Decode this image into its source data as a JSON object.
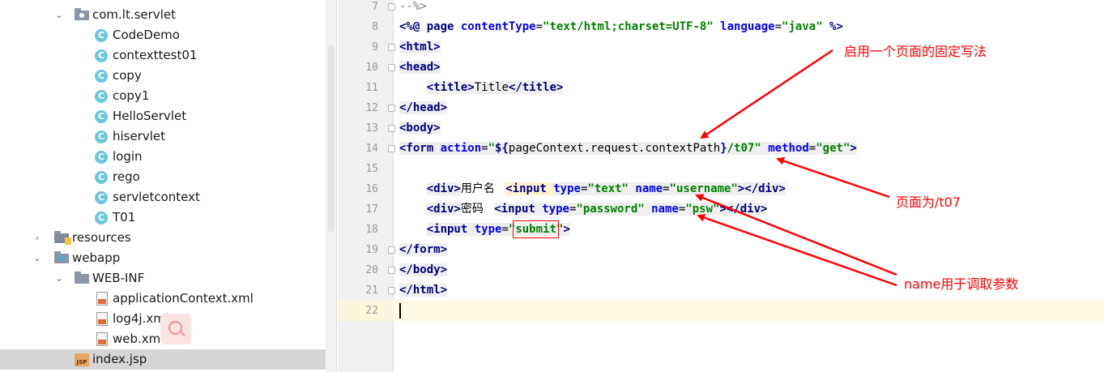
{
  "project_tree": {
    "items": [
      {
        "label": "com.lt.servlet",
        "kind": "package",
        "depth": 1,
        "expanded": true
      },
      {
        "label": "CodeDemo",
        "kind": "class",
        "depth": 2
      },
      {
        "label": "contexttest01",
        "kind": "class",
        "depth": 2
      },
      {
        "label": "copy",
        "kind": "class",
        "depth": 2
      },
      {
        "label": "copy1",
        "kind": "class",
        "depth": 2
      },
      {
        "label": "HelloServlet",
        "kind": "class",
        "depth": 2
      },
      {
        "label": "hiservlet",
        "kind": "class",
        "depth": 2
      },
      {
        "label": "login",
        "kind": "class",
        "depth": 2
      },
      {
        "label": "rego",
        "kind": "class",
        "depth": 2
      },
      {
        "label": "servletcontext",
        "kind": "class",
        "depth": 2
      },
      {
        "label": "T01",
        "kind": "class",
        "depth": 2
      },
      {
        "label": "resources",
        "kind": "resources",
        "depth": 0,
        "expanded": false
      },
      {
        "label": "webapp",
        "kind": "webapp",
        "depth": 0,
        "expanded": true
      },
      {
        "label": "WEB-INF",
        "kind": "folder",
        "depth": 1,
        "expanded": true
      },
      {
        "label": "applicationContext.xml",
        "kind": "xml",
        "depth": 2
      },
      {
        "label": "log4j.xml",
        "kind": "xml",
        "depth": 2
      },
      {
        "label": "web.xml",
        "kind": "xml",
        "depth": 2
      },
      {
        "label": "index.jsp",
        "kind": "jsp",
        "depth": 1,
        "selected": true
      }
    ],
    "class_icon_letter": "C",
    "jsp_icon_text": "JSP"
  },
  "editor": {
    "line_numbers": [
      "7",
      "8",
      "9",
      "10",
      "11",
      "12",
      "13",
      "14",
      "15",
      "16",
      "17",
      "18",
      "19",
      "20",
      "21",
      "22"
    ],
    "lines": {
      "l7": {
        "comment": "--%>"
      },
      "l8": {
        "open": "<%@ ",
        "kw": "page ",
        "a1": "contentType",
        "eq1": "=",
        "v1": "\"text/html;charset=UTF-8\"",
        "a2": " language",
        "eq2": "=",
        "v2": "\"java\"",
        "close": " %>"
      },
      "l9": {
        "t": "<html>"
      },
      "l10": {
        "t": "<head>"
      },
      "l11": {
        "t1": "<title>",
        "txt": "Title",
        "t2": "</title>"
      },
      "l12": {
        "t": "</head>"
      },
      "l13": {
        "t": "<body>"
      },
      "l14": {
        "t1": "<form ",
        "a1": "action",
        "eq1": "=",
        "v1a": "\"",
        "el": "${",
        "elbody": "pageContext.request.contextPath",
        "elend": "}",
        "v1b": "/t07\"",
        "a2": " method",
        "eq2": "=",
        "v2": "\"get\"",
        "t2": ">"
      },
      "l16": {
        "t1": "<div>",
        "txt": "用户名   ",
        "t2": "<input ",
        "a1": "type",
        "eq1": "=",
        "v1": "\"text\"",
        "a2": " name",
        "eq2": "=",
        "v2": "\"username\"",
        "t3": "></div>"
      },
      "l17": {
        "t1": "<div>",
        "txt": "密码   ",
        "t2": "<input ",
        "a1": "type",
        "eq1": "=",
        "v1": "\"password\"",
        "a2": " name",
        "eq2": "=",
        "v2": "\"psw\"",
        "t3": "></div>"
      },
      "l18": {
        "t1": "<input ",
        "a1": "type",
        "eq1": "=",
        "q1": "\"",
        "v1": "submit",
        "q2": "\"",
        "t2": ">"
      },
      "l19": {
        "t": "</form>"
      },
      "l20": {
        "t": "</body>"
      },
      "l21": {
        "t": "</html>"
      }
    }
  },
  "annotations": {
    "fixed_usage": "启用一个页面的固定写法",
    "page_t07": "页面为/t07",
    "name_param": "name用于调取参数",
    "color": "#ff0000"
  }
}
